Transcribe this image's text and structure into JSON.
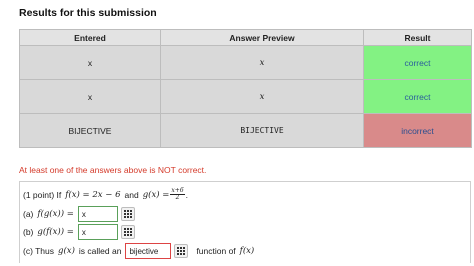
{
  "page": {
    "title": "Results for this submission"
  },
  "results_table": {
    "headers": [
      "Entered",
      "Answer Preview",
      "Result"
    ],
    "rows": [
      {
        "entered": "x",
        "preview": "x",
        "result": "correct"
      },
      {
        "entered": "x",
        "preview": "x",
        "result": "correct"
      },
      {
        "entered": "BIJECTIVE",
        "preview": "BIJECTIVE",
        "result": "incorrect"
      }
    ]
  },
  "colors": {
    "correct": "#83f283",
    "incorrect": "#d98a8a",
    "warning": "#d43a2a"
  },
  "warning_message": "At least one of the answers above is NOT correct.",
  "problem": {
    "intro_prefix": "(1 point) If",
    "f_def": "f(x) = 2x − 6",
    "and_word": "and",
    "g_def": "g(x) =",
    "g_frac_num": "x+6",
    "g_frac_den": "2",
    "intro_suffix": ".",
    "part_a_label": "(a)",
    "part_a_expr": "f(g(x)) =",
    "part_a_value": "x",
    "part_b_label": "(b)",
    "part_b_expr": "g(f(x)) =",
    "part_b_value": "x",
    "part_c_prefix": "(c) Thus",
    "part_c_gx": "g(x)",
    "part_c_mid": "is called an",
    "part_c_value": "bijective",
    "part_c_suffix": "function of",
    "part_c_fx": "f(x)"
  },
  "icons": {
    "equation_editor": "grid-icon"
  }
}
